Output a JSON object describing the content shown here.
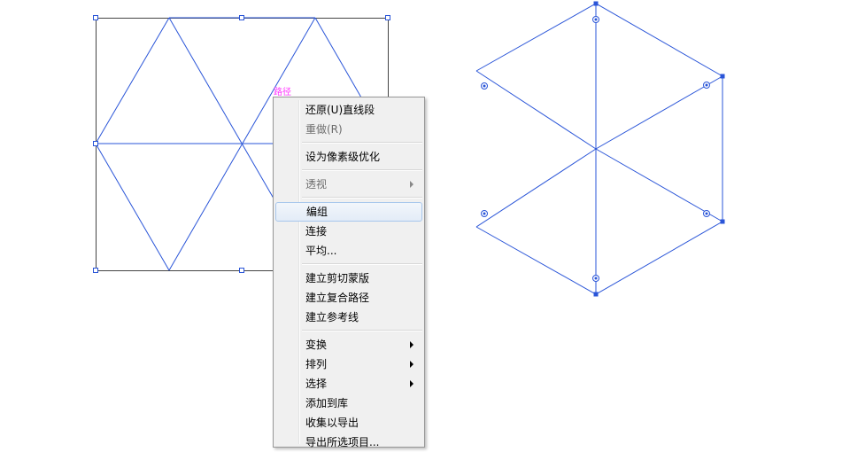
{
  "hint_label": "路径",
  "menu": {
    "groups": [
      [
        {
          "label": "还原(U)直线段"
        },
        {
          "label": "重做(R)",
          "disabled": true
        }
      ],
      [
        {
          "label": "设为像素级优化"
        }
      ],
      [
        {
          "label": "透视",
          "disabled": true,
          "submenu": true
        }
      ],
      [
        {
          "label": "编组",
          "highlighted": true
        },
        {
          "label": "连接"
        },
        {
          "label": "平均..."
        }
      ],
      [
        {
          "label": "建立剪切蒙版"
        },
        {
          "label": "建立复合路径"
        },
        {
          "label": "建立参考线"
        }
      ],
      [
        {
          "label": "变换",
          "submenu": true
        },
        {
          "label": "排列",
          "submenu": true
        },
        {
          "label": "选择",
          "submenu": true
        },
        {
          "label": "添加到库"
        },
        {
          "label": "收集以导出"
        },
        {
          "label": "导出所选项目..."
        }
      ]
    ]
  },
  "colors": {
    "path": "#2255dd",
    "hint": "#ff33ff"
  }
}
